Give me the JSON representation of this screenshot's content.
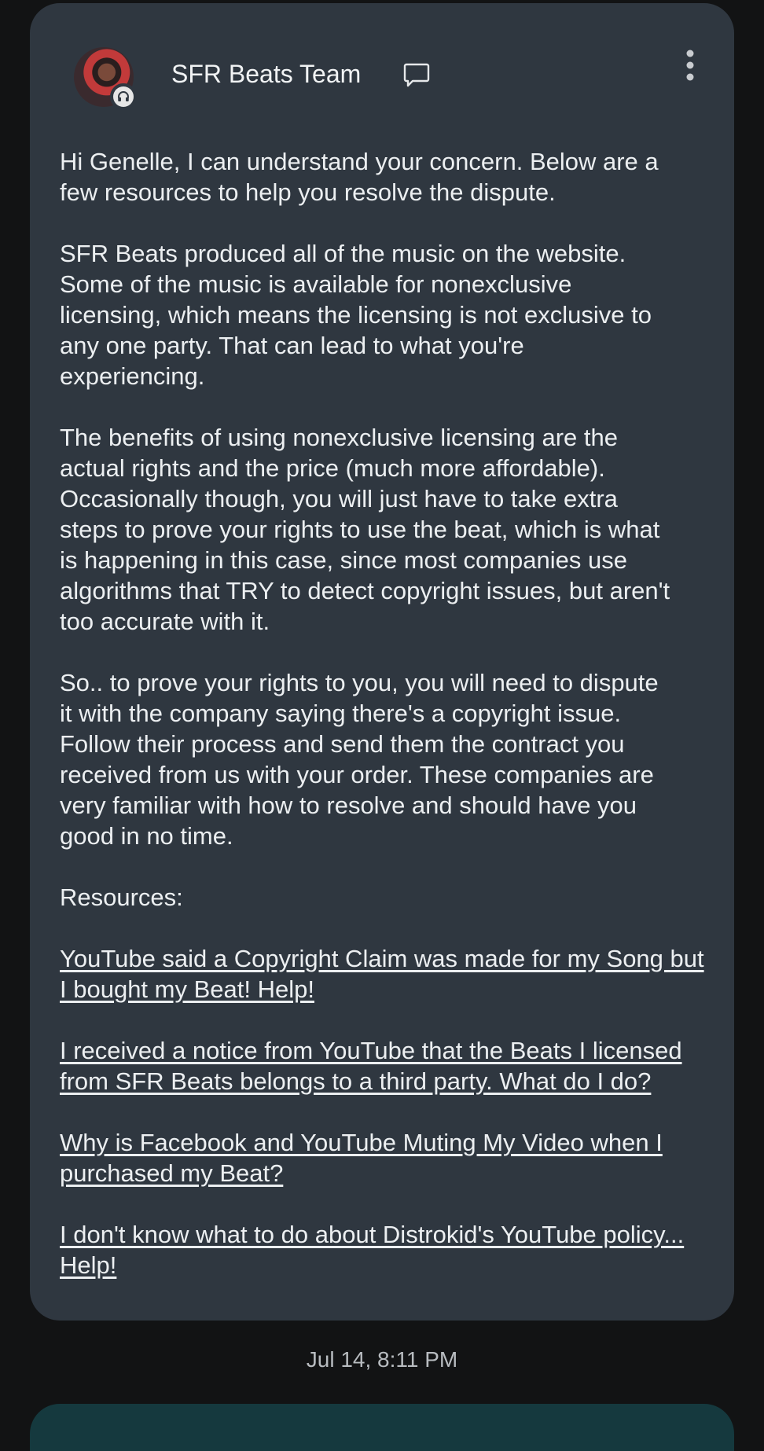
{
  "message": {
    "sender": "SFR Beats Team",
    "paragraphs": [
      "Hi Genelle, I can understand your concern.  Below are a\nfew resources to help you resolve the dispute.",
      "SFR Beats produced all of the music on the website.\n Some of the music is available for nonexclusive\nlicensing, which means the licensing is not exclusive to\nany one party.  That can lead to what you're\nexperiencing.",
      "The benefits of using nonexclusive licensing are the\nactual rights and the price (much more affordable).\n Occasionally though, you will just have to take extra\nsteps to prove your rights to use the beat, which is what\nis happening in this case, since most companies use\nalgorithms that TRY to detect copyright issues, but aren't\ntoo accurate with it.",
      "So.. to prove your rights to you, you will need to dispute\nit with the company saying there's a copyright issue.\n Follow their process and send them the contract you\nreceived from us with your order.  These companies are\nvery familiar with how to resolve and should have you\ngood in no time.",
      "Resources:"
    ],
    "links": [
      "YouTube said a Copyright Claim was made for my Song but I bought my Beat! Help!",
      "I received a notice from YouTube that the Beats I licensed from SFR Beats belongs to a third party. What do I do?",
      "Why is Facebook and YouTube Muting My Video when I purchased my Beat?",
      "I don't know what to do about Distrokid's YouTube policy... Help!"
    ],
    "timestamp": "Jul 14, 8:11 PM"
  },
  "icons": {
    "avatar_badge": "headset-icon",
    "chat": "chat-bubble-icon",
    "more": "more-vert-icon"
  },
  "colors": {
    "background": "#121314",
    "card": "#2f3740",
    "text": "#eceff1",
    "timestamp": "#b8bcc0",
    "next_bubble": "#15393e"
  }
}
